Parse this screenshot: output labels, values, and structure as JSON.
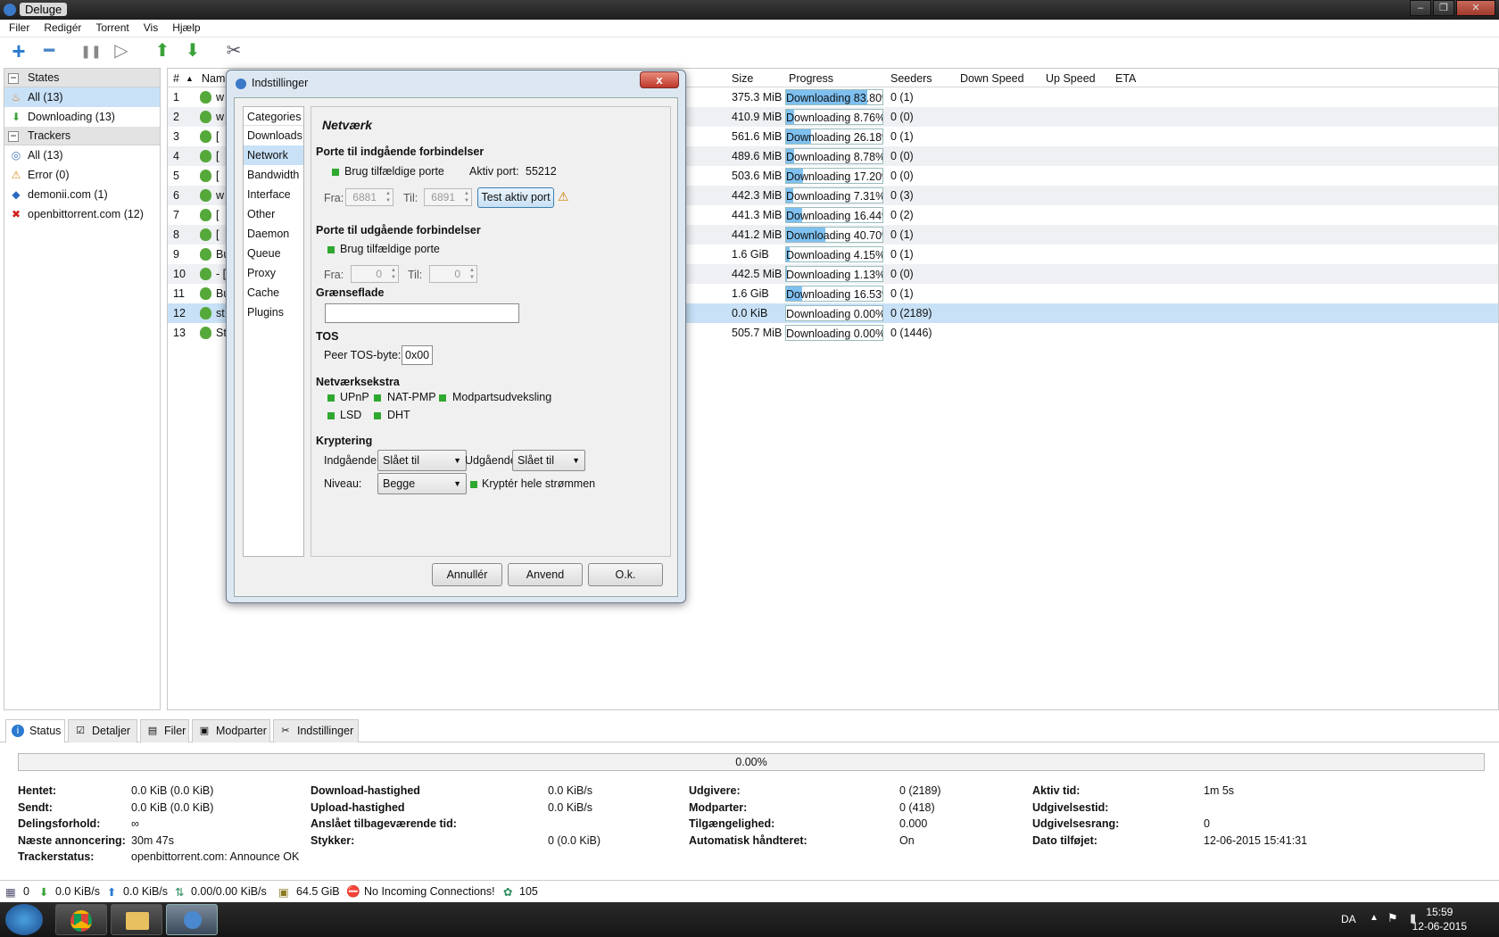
{
  "window": {
    "title": "Deluge",
    "controls": [
      "–",
      "❐",
      "✕"
    ]
  },
  "menu": [
    "Filer",
    "Redigér",
    "Torrent",
    "Vis",
    "Hjælp"
  ],
  "toolbar": {
    "icons": [
      "add-icon",
      "remove-icon",
      "pause-icon",
      "resume-icon",
      "queue-up-icon",
      "queue-down-icon",
      "preferences-icon"
    ],
    "glyphs": {
      "add": "+",
      "remove": "━",
      "pause": "❚❚",
      "resume": "▷",
      "up": "⬆",
      "down": "⬇",
      "prefs": "✂"
    }
  },
  "sidebar": {
    "states_header": "States",
    "states": [
      {
        "label": "All (13)",
        "icon": "all-icon"
      },
      {
        "label": "Downloading (13)",
        "icon": "downloading-icon"
      }
    ],
    "trackers_header": "Trackers",
    "trackers": [
      {
        "label": "All (13)",
        "icon": "globe-icon"
      },
      {
        "label": "Error (0)",
        "icon": "warning-icon"
      },
      {
        "label": "demonii.com (1)",
        "icon": "tracker-icon"
      },
      {
        "label": "openbittorrent.com (12)",
        "icon": "tracker-icon"
      }
    ]
  },
  "list": {
    "columns": {
      "num": "#",
      "sort": "▲",
      "name": "Nam",
      "size": "Size",
      "progress": "Progress",
      "seeders": "Seeders",
      "down": "Down Speed",
      "up": "Up Speed",
      "eta": "ETA"
    },
    "rows": [
      {
        "num": "1",
        "name": "w",
        "size": "375.3 MiB",
        "progress": "Downloading 83.80%",
        "pct": 83.8,
        "seeders": "0 (1)"
      },
      {
        "num": "2",
        "name": "w",
        "size": "410.9 MiB",
        "progress": "Downloading 8.76%",
        "pct": 8.76,
        "seeders": "0 (0)"
      },
      {
        "num": "3",
        "name": "[",
        "size": "561.6 MiB",
        "progress": "Downloading 26.18%",
        "pct": 26.18,
        "seeders": "0 (1)"
      },
      {
        "num": "4",
        "name": "[",
        "size": "489.6 MiB",
        "progress": "Downloading 8.78%",
        "pct": 8.78,
        "seeders": "0 (0)"
      },
      {
        "num": "5",
        "name": "[",
        "size": "503.6 MiB",
        "progress": "Downloading 17.20%",
        "pct": 17.2,
        "seeders": "0 (0)"
      },
      {
        "num": "6",
        "name": "w",
        "size": "442.3 MiB",
        "progress": "Downloading 7.31%",
        "pct": 7.31,
        "seeders": "0 (3)"
      },
      {
        "num": "7",
        "name": "[",
        "size": "441.3 MiB",
        "progress": "Downloading 16.44%",
        "pct": 16.44,
        "seeders": "0 (2)"
      },
      {
        "num": "8",
        "name": "[",
        "size": "441.2 MiB",
        "progress": "Downloading 40.70%",
        "pct": 40.7,
        "seeders": "0 (1)"
      },
      {
        "num": "9",
        "name": "Bu",
        "size": "1.6 GiB",
        "progress": "Downloading 4.15%",
        "pct": 4.15,
        "seeders": "0 (1)"
      },
      {
        "num": "10",
        "name": "- [",
        "size": "442.5 MiB",
        "progress": "Downloading 1.13%",
        "pct": 1.13,
        "seeders": "0 (0)"
      },
      {
        "num": "11",
        "name": "Bu",
        "size": "1.6 GiB",
        "progress": "Downloading 16.53%",
        "pct": 16.53,
        "seeders": "0 (1)"
      },
      {
        "num": "12",
        "name": "st",
        "size": "0.0 KiB",
        "progress": "Downloading 0.00%",
        "pct": 0,
        "seeders": "0 (2189)"
      },
      {
        "num": "13",
        "name": "St",
        "size": "505.7 MiB",
        "progress": "Downloading 0.00%",
        "pct": 0,
        "seeders": "0 (1446)"
      }
    ],
    "selected_row": 12
  },
  "tabs": [
    {
      "label": "Status",
      "icon": "info-icon",
      "glyph": "i"
    },
    {
      "label": "Detaljer",
      "icon": "details-icon",
      "glyph": "☑"
    },
    {
      "label": "Filer",
      "icon": "files-icon",
      "glyph": "▤"
    },
    {
      "label": "Modparter",
      "icon": "peers-icon",
      "glyph": "▣"
    },
    {
      "label": "Indstillinger",
      "icon": "settings-icon",
      "glyph": "✂"
    }
  ],
  "status": {
    "progress": "0.00%",
    "col1": [
      {
        "k": "Hentet:",
        "v": "0.0 KiB (0.0 KiB)"
      },
      {
        "k": "Sendt:",
        "v": "0.0 KiB (0.0 KiB)"
      },
      {
        "k": "Delingsforhold:",
        "v": "∞"
      },
      {
        "k": "Næste annoncering:",
        "v": "30m 47s"
      },
      {
        "k": "Trackerstatus:",
        "v": "openbittorrent.com: Announce OK"
      }
    ],
    "col2": [
      {
        "k": "Download-hastighed",
        "v": "0.0 KiB/s"
      },
      {
        "k": "Upload-hastighed",
        "v": "0.0 KiB/s"
      },
      {
        "k": "Anslået tilbageværende tid:",
        "v": ""
      },
      {
        "k": "Stykker:",
        "v": "0 (0.0 KiB)"
      }
    ],
    "col3": [
      {
        "k": "Udgivere:",
        "v": "0 (2189)"
      },
      {
        "k": "Modparter:",
        "v": "0 (418)"
      },
      {
        "k": "Tilgængelighed:",
        "v": "0.000"
      },
      {
        "k": "Automatisk håndteret:",
        "v": "On"
      }
    ],
    "col4": [
      {
        "k": "Aktiv tid:",
        "v": "1m 5s"
      },
      {
        "k": "Udgivelsestid:",
        "v": ""
      },
      {
        "k": "Udgivelsesrang:",
        "v": "0"
      },
      {
        "k": "Dato tilføjet:",
        "v": "12-06-2015 15:41:31"
      }
    ]
  },
  "statusbar": {
    "connections": "0",
    "down": "0.0 KiB/s",
    "up": "0.0 KiB/s",
    "protocol": "0.00/0.00 KiB/s",
    "disk": "64.5 GiB",
    "incoming": "No Incoming Connections!",
    "dht": "105"
  },
  "taskbar": {
    "lang": "DA",
    "time": "15:59",
    "date": "12-06-2015"
  },
  "dialog": {
    "title": "Indstillinger",
    "close": "x",
    "categories_header": "Categories",
    "categories": [
      "Downloads",
      "Network",
      "Bandwidth",
      "Interface",
      "Other",
      "Daemon",
      "Queue",
      "Proxy",
      "Cache",
      "Plugins"
    ],
    "selected_category": "Network",
    "pane_title": "Netværk",
    "in_ports_header": "Porte til indgående forbindelser",
    "in_random_label": "Brug tilfældige porte",
    "active_port_label": "Aktiv port:",
    "active_port": "55212",
    "from_label": "Fra:",
    "from_value": "6881",
    "to_label": "Til:",
    "to_value": "6891",
    "test_button": "Test aktiv port",
    "out_ports_header": "Porte til udgående forbindelser",
    "out_random_label": "Brug tilfældige porte",
    "out_from_label": "Fra:",
    "out_from_value": "0",
    "out_to_label": "Til:",
    "out_to_value": "0",
    "interface_header": "Grænseflade",
    "interface_value": "",
    "tos_header": "TOS",
    "tos_label": "Peer TOS-byte:",
    "tos_value": "0x00",
    "extras_header": "Netværksekstra",
    "upnp": "UPnP",
    "natpmp": "NAT-PMP",
    "pex": "Modpartsudveksling",
    "lsd": "LSD",
    "dht": "DHT",
    "enc_header": "Kryptering",
    "incoming_label": "Indgående",
    "incoming_value": "Slået til",
    "outgoing_label": "Udgående",
    "outgoing_value": "Slået til",
    "level_label": "Niveau:",
    "level_value": "Begge",
    "encrypt_all": "Kryptér hele strømmen",
    "cancel": "Annullér",
    "apply": "Anvend",
    "ok": "O.k."
  },
  "colors": {
    "selection": "#c8e1f7",
    "progress_fill": "#7ec0f0",
    "check": "#2fa82f",
    "torrent_icon": "#55a83a"
  }
}
